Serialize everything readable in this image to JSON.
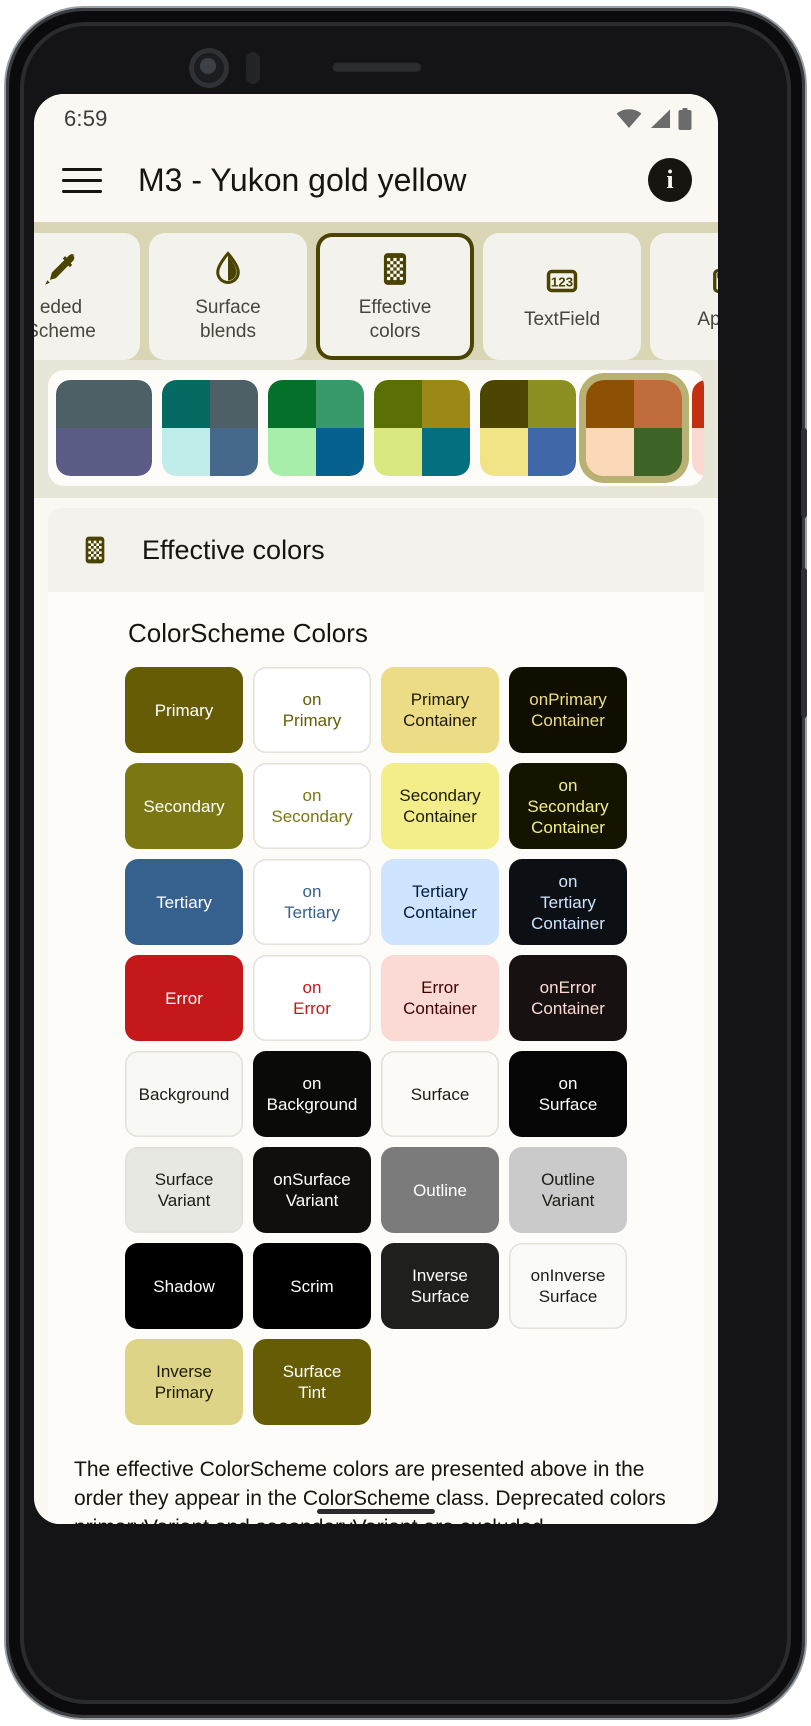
{
  "status_bar": {
    "time": "6:59",
    "icons": [
      "wifi-icon",
      "cell-signal-icon",
      "battery-icon"
    ]
  },
  "app_bar": {
    "menu_icon": "hamburger-menu-icon",
    "title": "M3 -  Yukon gold yellow",
    "info_icon": "info-icon"
  },
  "tabs": {
    "selected_index": 2,
    "items": [
      {
        "line1": "eded",
        "line2": "Scheme",
        "icon": "eyedropper-icon"
      },
      {
        "line1": "Surface",
        "line2": "blends",
        "icon": "water-drop-icon"
      },
      {
        "line1": "Effective",
        "line2": "colors",
        "icon": "checkerboard-icon"
      },
      {
        "line1": "TextField",
        "line2": "",
        "icon": "123-icon"
      },
      {
        "line1": "AppBar",
        "line2": "",
        "icon": "appbar-icon"
      }
    ]
  },
  "palette": {
    "selected_index": 5,
    "themes": [
      {
        "tl": "#4c6066",
        "tr": "#4c6066",
        "bl": "#5c5d86",
        "br": "#5c5d86"
      },
      {
        "tl": "#056b62",
        "tr": "#4c6066",
        "bl": "#c0ece9",
        "br": "#46688b"
      },
      {
        "tl": "#047029",
        "tr": "#38996b",
        "bl": "#a6eeaa",
        "br": "#07618f"
      },
      {
        "tl": "#5a7004",
        "tr": "#9c8817",
        "bl": "#dbe880",
        "br": "#036f7f"
      },
      {
        "tl": "#4d4602",
        "tr": "#8c9023",
        "bl": "#f1e487",
        "br": "#4068a8"
      },
      {
        "tl": "#8e5005",
        "tr": "#c06c3c",
        "bl": "#fbd8b8",
        "br": "#3e6326"
      },
      {
        "tl": "#c3300f",
        "tr": "#c35b46",
        "bl": "#fbd8d2",
        "br": "#3e6326"
      },
      {
        "tl": "#06457f",
        "tr": "#c3300f",
        "bl": "#c7dcfb",
        "br": "#06666b"
      },
      {
        "tl": "#c3300f",
        "tr": "#c3300f",
        "bl": "#fbd8d2",
        "br": "#fbd8d2"
      }
    ]
  },
  "card": {
    "header_icon": "checkerboard-icon",
    "header_title": "Effective colors",
    "section_title": "ColorScheme Colors",
    "footer_note": "The effective ColorScheme colors are presented above in the order they appear in the ColorScheme class. Deprecated colors primaryVariant and secondaryVariant are excluded."
  },
  "color_chips": [
    {
      "label": "Primary",
      "bg": "#665c05",
      "fg": "#ffffff",
      "bordered": false
    },
    {
      "label": "on\nPrimary",
      "bg": "#ffffff",
      "fg": "#665c05",
      "bordered": true
    },
    {
      "label": "Primary\nContainer",
      "bg": "#ecdc85",
      "fg": "#1d1a00",
      "bordered": false
    },
    {
      "label": "onPrimary\nContainer",
      "bg": "#100e00",
      "fg": "#ecdc85",
      "bordered": false
    },
    {
      "label": "Secondary",
      "bg": "#7b7712",
      "fg": "#ffffff",
      "bordered": false
    },
    {
      "label": "on\nSecondary",
      "bg": "#ffffff",
      "fg": "#7b7712",
      "bordered": true
    },
    {
      "label": "Secondary\nContainer",
      "bg": "#f3ee89",
      "fg": "#1d1c00",
      "bordered": false
    },
    {
      "label": "on\nSecondary\nContainer",
      "bg": "#151400",
      "fg": "#f3ee89",
      "bordered": false
    },
    {
      "label": "Tertiary",
      "bg": "#36618e",
      "fg": "#ffffff",
      "bordered": false
    },
    {
      "label": "on\nTertiary",
      "bg": "#ffffff",
      "fg": "#36618e",
      "bordered": true
    },
    {
      "label": "Tertiary\nContainer",
      "bg": "#cfe4ff",
      "fg": "#001c37",
      "bordered": false
    },
    {
      "label": "on\nTertiary\nContainer",
      "bg": "#0c0f13",
      "fg": "#cfe4ff",
      "bordered": false
    },
    {
      "label": "Error",
      "bg": "#c4181b",
      "fg": "#ffffff",
      "bordered": false
    },
    {
      "label": "on\nError",
      "bg": "#ffffff",
      "fg": "#c4181b",
      "bordered": true
    },
    {
      "label": "Error\nContainer",
      "bg": "#fbdad5",
      "fg": "#410002",
      "bordered": false
    },
    {
      "label": "onError\nContainer",
      "bg": "#181111",
      "fg": "#fbdad5",
      "bordered": false
    },
    {
      "label": "Background",
      "bg": "#f8f8f4",
      "fg": "#1c1c17",
      "bordered": true
    },
    {
      "label": "on\nBackground",
      "bg": "#0a0a08",
      "fg": "#ffffff",
      "bordered": false
    },
    {
      "label": "Surface",
      "bg": "#fdfbf7",
      "fg": "#1c1c17",
      "bordered": true
    },
    {
      "label": "on\nSurface",
      "bg": "#050505",
      "fg": "#ffffff",
      "bordered": false
    },
    {
      "label": "Surface\nVariant",
      "bg": "#e8e8e2",
      "fg": "#1c1c17",
      "bordered": true
    },
    {
      "label": "onSurface\nVariant",
      "bg": "#100f0c",
      "fg": "#ffffff",
      "bordered": false
    },
    {
      "label": "Outline",
      "bg": "#7b7b7b",
      "fg": "#ffffff",
      "bordered": false
    },
    {
      "label": "Outline\nVariant",
      "bg": "#cacaca",
      "fg": "#1c1c17",
      "bordered": false
    },
    {
      "label": "Shadow",
      "bg": "#000000",
      "fg": "#ffffff",
      "bordered": false
    },
    {
      "label": "Scrim",
      "bg": "#000000",
      "fg": "#ffffff",
      "bordered": false
    },
    {
      "label": "Inverse\nSurface",
      "bg": "#1f1f1d",
      "fg": "#ffffff",
      "bordered": false
    },
    {
      "label": "onInverse\nSurface",
      "bg": "#fafaf8",
      "fg": "#1c1c17",
      "bordered": true
    },
    {
      "label": "Inverse\nPrimary",
      "bg": "#ddd488",
      "fg": "#1d1a00",
      "bordered": false
    },
    {
      "label": "Surface\nTint",
      "bg": "#665c05",
      "fg": "#ffffff",
      "bordered": false
    }
  ]
}
